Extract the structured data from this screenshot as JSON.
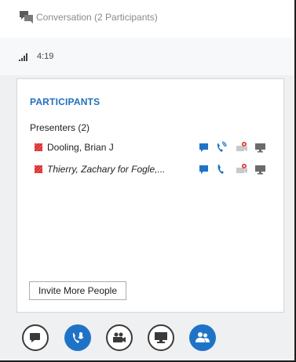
{
  "titlebar": {
    "title": "Conversation (2 Participants)"
  },
  "status": {
    "timer": "4:19"
  },
  "participants": {
    "heading": "PARTICIPANTS",
    "group_label": "Presenters (2)",
    "people": [
      {
        "name": "Dooling, Brian J",
        "presence": "busy"
      },
      {
        "name": "Thierry, Zachary for Fogle,...",
        "presence": "busy"
      }
    ],
    "invite_label": "Invite More People"
  },
  "toolbar": {
    "buttons": [
      {
        "icon": "chat-icon"
      },
      {
        "icon": "microphone-icon",
        "active": true
      },
      {
        "icon": "video-icon"
      },
      {
        "icon": "present-icon"
      },
      {
        "icon": "people-icon",
        "active": true
      }
    ]
  },
  "colors": {
    "accent": "#1f73c7",
    "heading": "#1f6fbf",
    "presence_busy": "#d32f2f"
  }
}
